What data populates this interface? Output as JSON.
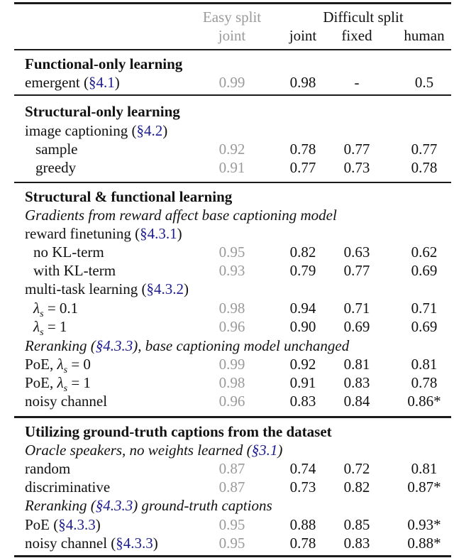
{
  "header": {
    "easy_split": "Easy split",
    "difficult_split": "Difficult split",
    "easy_cols": [
      "joint"
    ],
    "difficult_cols": [
      "joint",
      "fixed",
      "human"
    ]
  },
  "sections": [
    {
      "title": "Functional-only learning",
      "rows": [
        {
          "label": "emergent (",
          "ref": "§4.1",
          "label_after": ")",
          "easy": "0.99",
          "joint": "0.98",
          "fixed": "-",
          "human": "0.5"
        }
      ]
    },
    {
      "title": "Structural-only learning",
      "group": {
        "label": "image captioning (",
        "ref": "§4.2",
        "label_after": ")"
      },
      "rows": [
        {
          "label": "sample",
          "easy": "0.92",
          "joint": "0.78",
          "fixed": "0.77",
          "human": "0.77"
        },
        {
          "label": "greedy",
          "easy": "0.91",
          "joint": "0.77",
          "fixed": "0.73",
          "human": "0.78"
        }
      ]
    },
    {
      "title": "Structural & functional learning",
      "subtitle1": "Gradients from reward affect base captioning model",
      "group1": {
        "label": "reward finetuning (",
        "ref": "§4.3.1",
        "label_after": ")"
      },
      "rows1": [
        {
          "label": "no KL-term",
          "easy": "0.95",
          "joint": "0.82",
          "fixed": "0.63",
          "human": "0.62"
        },
        {
          "label": "with KL-term",
          "easy": "0.93",
          "joint": "0.79",
          "fixed": "0.77",
          "human": "0.69"
        }
      ],
      "group2": {
        "label": "multi-task learning (",
        "ref": "§4.3.2",
        "label_after": ")"
      },
      "rows2": [
        {
          "lambda": "λ",
          "sub": "s",
          "eq": " = 0.1",
          "easy": "0.98",
          "joint": "0.94",
          "fixed": "0.71",
          "human": "0.71"
        },
        {
          "lambda": "λ",
          "sub": "s",
          "eq": " = 1",
          "easy": "0.96",
          "joint": "0.90",
          "fixed": "0.69",
          "human": "0.69"
        }
      ],
      "subtitle2": {
        "before": "Reranking (",
        "ref": "§4.3.3",
        "after": "), base captioning model unchanged"
      },
      "rows3": [
        {
          "prefix": "PoE, ",
          "lambda": "λ",
          "sub": "s",
          "eq": " = 0",
          "easy": "0.99",
          "joint": "0.92",
          "fixed": "0.81",
          "human": "0.81"
        },
        {
          "prefix": "PoE, ",
          "lambda": "λ",
          "sub": "s",
          "eq": " = 1",
          "easy": "0.98",
          "joint": "0.91",
          "fixed": "0.83",
          "human": "0.78"
        },
        {
          "label": "noisy channel",
          "easy": "0.96",
          "joint": "0.83",
          "fixed": "0.84",
          "human": "0.86*"
        }
      ]
    },
    {
      "title": "Utilizing ground-truth captions from the dataset",
      "subtitle1": {
        "before": "Oracle speakers, no weights learned (",
        "ref": "§3.1",
        "after": ")"
      },
      "rows1": [
        {
          "label": "random",
          "easy": "0.87",
          "joint": "0.74",
          "fixed": "0.72",
          "human": "0.81"
        },
        {
          "label": "discriminative",
          "easy": "0.87",
          "joint": "0.73",
          "fixed": "0.82",
          "human": "0.87*"
        }
      ],
      "subtitle2": {
        "before": "Reranking (",
        "ref": "§4.3.3",
        "after": ") ground-truth captions"
      },
      "rows2": [
        {
          "label": "PoE (",
          "ref": "§4.3.3",
          "label_after": ")",
          "easy": "0.95",
          "joint": "0.88",
          "fixed": "0.85",
          "human": "0.93*"
        },
        {
          "label": "noisy channel (",
          "ref": "§4.3.3",
          "label_after": ")",
          "easy": "0.95",
          "joint": "0.78",
          "fixed": "0.83",
          "human": "0.88*"
        }
      ]
    }
  ],
  "colors": {
    "easy_gray": "#9a9a9a",
    "ref_blue": "#1c1c8f",
    "text": "#111111"
  }
}
